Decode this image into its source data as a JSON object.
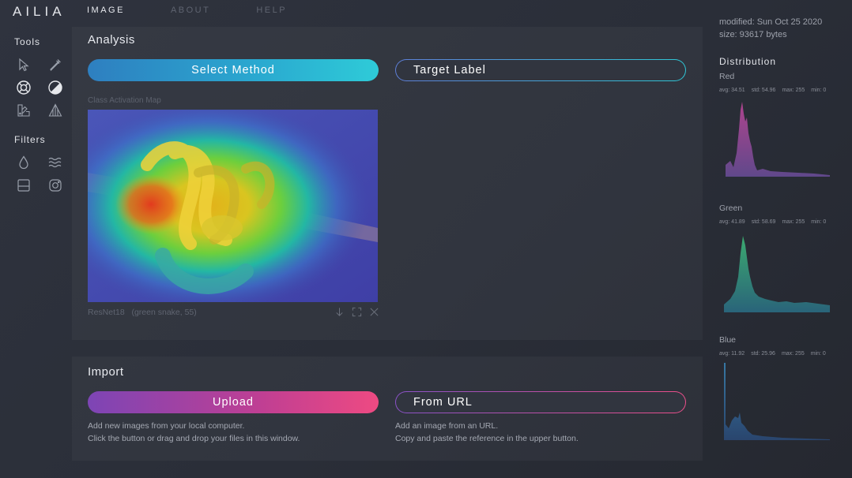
{
  "app": {
    "logo": "AILIA"
  },
  "nav": [
    {
      "label": "IMAGE",
      "active": true
    },
    {
      "label": "ABOUT",
      "active": false
    },
    {
      "label": "HELP",
      "active": false
    }
  ],
  "sidebar": {
    "tools_title": "Tools",
    "tools": [
      "cursor-icon",
      "eyedropper-icon",
      "lifebuoy-icon",
      "contrast-icon",
      "palette-icon",
      "sharpen-icon"
    ],
    "filters_title": "Filters",
    "filters": [
      "drop-icon",
      "waves-icon",
      "frame-icon",
      "instagram-icon"
    ]
  },
  "analysis": {
    "title": "Analysis",
    "select_method": "Select Method",
    "target_label": "Target Label",
    "cam_label": "Class Activation Map",
    "model": "ResNet18",
    "prediction": "(green snake, 55)",
    "actions": [
      "download-icon",
      "expand-icon",
      "close-icon"
    ]
  },
  "import": {
    "title": "Import",
    "upload": "Upload",
    "from_url": "From URL",
    "upload_help_1": "Add new images from your local computer.",
    "upload_help_2": "Click the button or drag and drop your files in this window.",
    "url_help_1": "Add an image from an URL.",
    "url_help_2": "Copy and paste the reference in the upper button."
  },
  "info": {
    "modified": "modified: Sun Oct 25 2020",
    "size": "size: 93617 bytes"
  },
  "distribution": {
    "title": "Distribution",
    "channels": [
      {
        "name": "Red",
        "avg": "avg: 34.51",
        "std": "std: 54.96",
        "max": "max: 255",
        "min": "min: 0",
        "color": "#b24a9c"
      },
      {
        "name": "Green",
        "avg": "avg: 41.89",
        "std": "std: 58.69",
        "max": "max: 255",
        "min": "min: 0",
        "color": "#3fae7a"
      },
      {
        "name": "Blue",
        "avg": "avg: 11.92",
        "std": "std: 25.96",
        "max": "max: 255",
        "min": "min: 0",
        "color": "#3a78a8"
      }
    ]
  },
  "colors": {
    "accent_blue": "#2aa6cf",
    "accent_pink": "#ee4a82",
    "background": "#2c303a"
  }
}
